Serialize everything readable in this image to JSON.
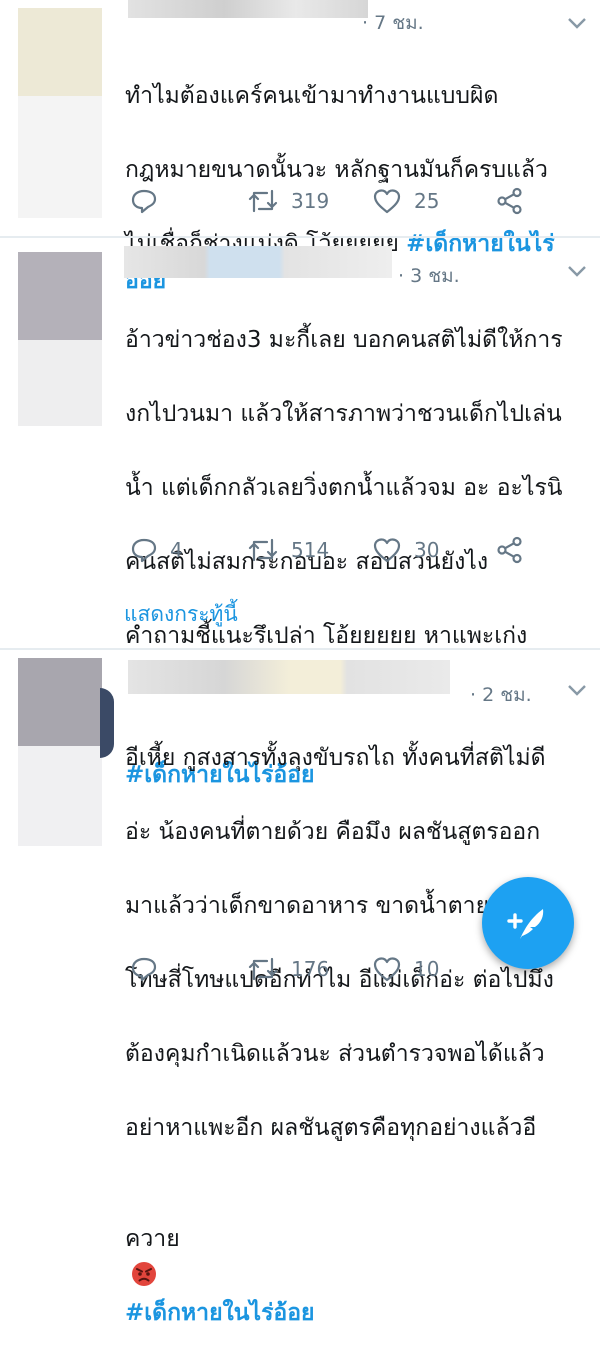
{
  "tweets": [
    {
      "time": "· 7 ชม.",
      "lines": [
        "ทำไมต้องแคร์คนเข้ามาทำงานแบบผิด",
        "กฎหมายขนาดนั้นวะ หลักฐานมันก็ครบแล้ว",
        "ไม่เชื่อก็ช่างแม่งดิ โว้ยยยยย "
      ],
      "hashtag": "#เด็กหายในไร่อ้อย",
      "reply_count": "",
      "retweet_count": "319",
      "like_count": "25"
    },
    {
      "time": "· 3 ชม.",
      "lines": [
        "อ้าวข่าวช่อง3 มะกี้เลย บอกคนสติไม่ดีให้การ",
        "งกไปวนมา แล้วให้สารภาพว่าชวนเด็กไปเล่น",
        "น้ำ แต่เด็กกลัวเลยวิ่งตกน้ำแล้วจม อะ อะไรนิ",
        "คนสติไม่สมกระกอบอะ สอบสวนยังไง",
        "คำถามชี้แนะรึเปล่า โอ้ยยยยย หาแพะเก่ง"
      ],
      "hashtag": "#เด็กหายในไร่อ้อย",
      "reply_count": "4",
      "retweet_count": "514",
      "like_count": "30",
      "show_thread": "แสดงกระทู้นี้"
    },
    {
      "time": "· 2 ชม.",
      "lines": [
        "อีเหี้ย กูสงสารทั้งลุงขับรถไถ ทั้งคนที่สติไม่ดี",
        "อ่ะ น้องคนที่ตายด้วย คือมึง ผลชันสูตรออก",
        "มาแล้วว่าเด็กขาดอาหาร ขาดน้ำตาย แล้วจะ",
        "โทษสี่โทษแปดอีกทำไม อีแม่เด็กอ่ะ ต่อไปมึง",
        "ต้องคุมกำเนิดแล้วนะ ส่วนตำรวจพอได้แล้ว",
        "อย่าหาแพะอีก ผลชันสูตรคือทุกอย่างแล้วอี"
      ],
      "last_line": "ควาย",
      "emoji": "angry-face",
      "hashtag": "#เด็กหายในไร่อ้อย",
      "reply_count": "",
      "retweet_count": "176",
      "like_count": "10"
    }
  ],
  "colors": {
    "accent": "#1da1f2",
    "link": "#1b95e0",
    "muted": "#657786"
  }
}
